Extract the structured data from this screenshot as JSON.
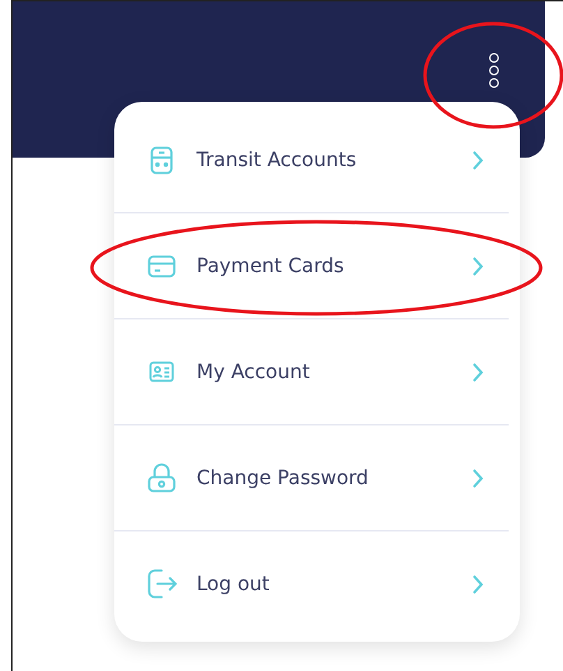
{
  "menu": {
    "items": [
      {
        "label": "Transit Accounts",
        "kind": "transit",
        "highlighted": false
      },
      {
        "label": "Payment Cards",
        "kind": "card",
        "highlighted": true
      },
      {
        "label": "My Account",
        "kind": "account",
        "highlighted": false
      },
      {
        "label": "Change Password",
        "kind": "lock",
        "highlighted": false
      },
      {
        "label": "Log out",
        "kind": "logout",
        "highlighted": false
      }
    ]
  },
  "header": {
    "kebab_highlighted": true
  }
}
